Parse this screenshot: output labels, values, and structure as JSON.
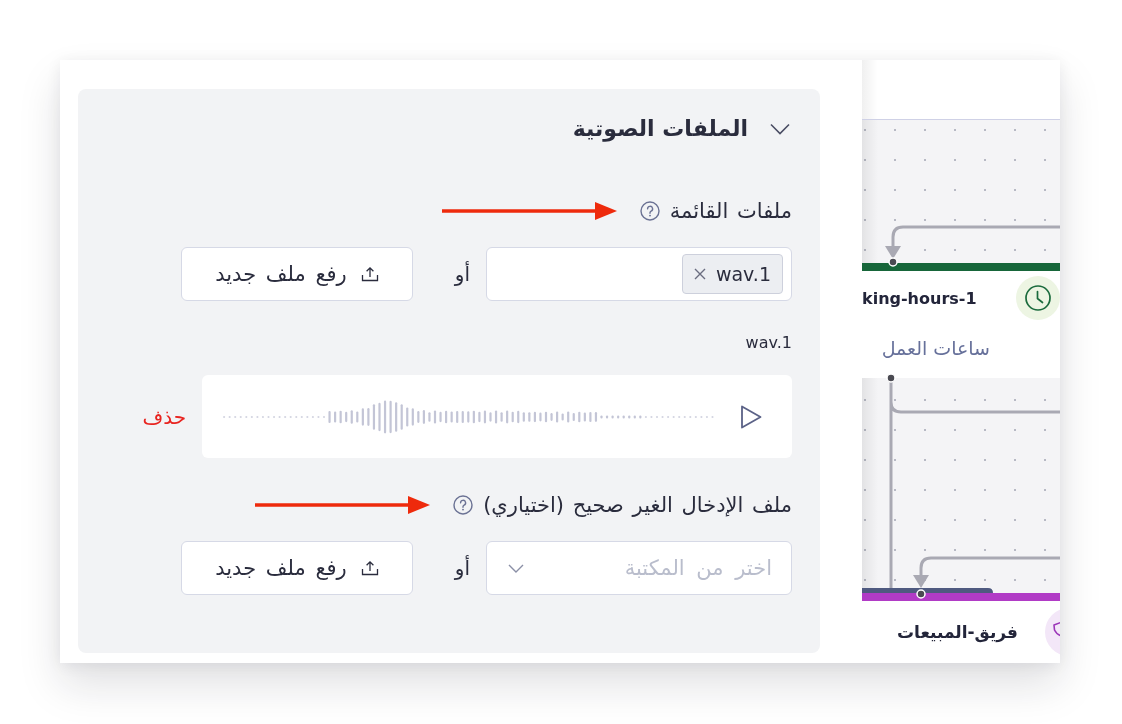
{
  "panel": {
    "title": "الملفات الصوتية",
    "expanded": true,
    "fields": [
      {
        "kind": "file_list",
        "label": "ملفات القائمة",
        "annotated": true,
        "tags": [
          "wav.1"
        ],
        "or_text": "أو",
        "upload_button": "رفع ملف جديد",
        "files": [
          {
            "name": "wav.1",
            "delete": "حذف"
          }
        ]
      },
      {
        "kind": "library_select",
        "label": "ملف الإدخال الغير صحيح (اختياري)",
        "annotated": true,
        "placeholder": "اختر من المكتبة",
        "or_text": "أو",
        "upload_button": "رفع ملف جديد"
      }
    ]
  },
  "canvas": {
    "nodes": [
      {
        "kind": "schedule",
        "title": "king-hours-1",
        "subtitle": "ساعات العمل",
        "color": "#17663a"
      },
      {
        "kind": "team",
        "title": "فريق-المبيعات",
        "color": "#b13bc6"
      }
    ]
  }
}
